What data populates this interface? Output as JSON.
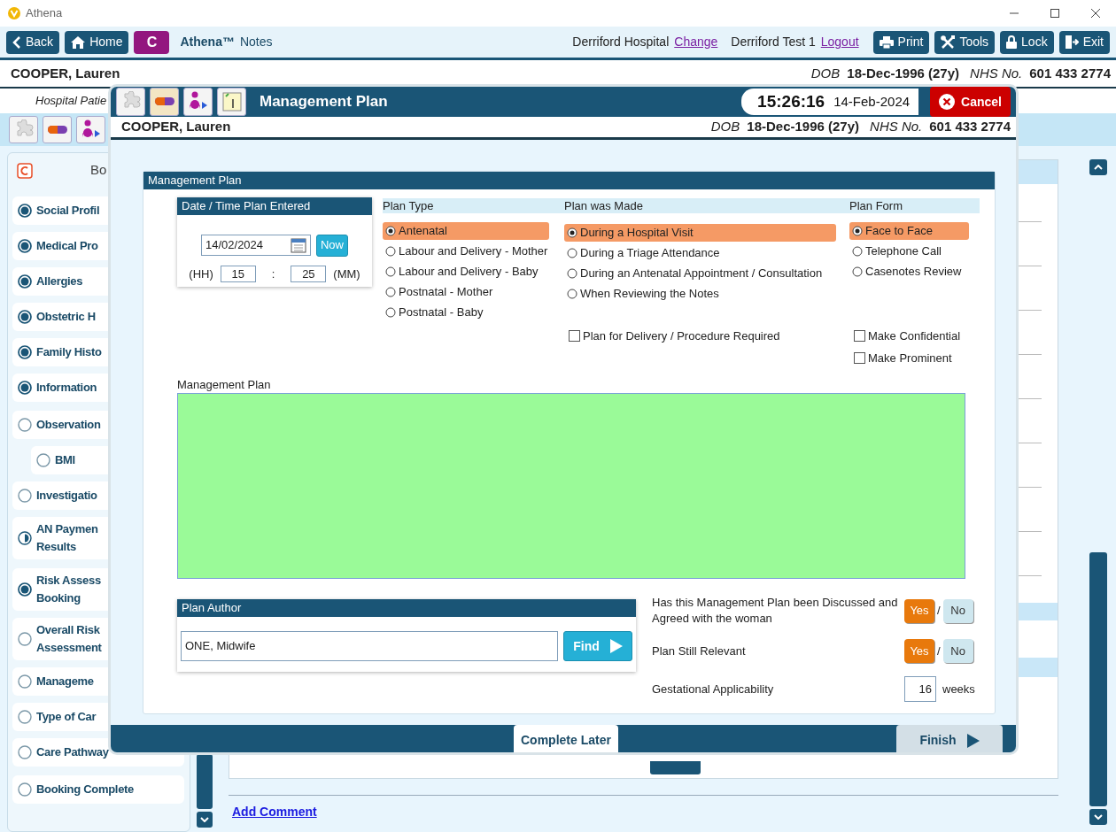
{
  "window": {
    "title": "Athena"
  },
  "toolbar": {
    "left_buttons": [
      {
        "label": "Back"
      },
      {
        "label": "Home"
      }
    ],
    "brand_button": "C",
    "app_name": "Athena™",
    "app_suffix": "Notes",
    "location": "Derriford Hospital",
    "location_link": "Change",
    "user": "Derriford Test 1",
    "user_link": "Logout",
    "right_buttons": [
      {
        "label": "Print"
      },
      {
        "label": "Tools"
      },
      {
        "label": "Lock"
      },
      {
        "label": "Exit"
      }
    ]
  },
  "patient": {
    "name": "COOPER, Lauren",
    "dob_label": "DOB",
    "dob": "18-Dec-1996 (27y)",
    "nhs_label": "NHS No.",
    "nhs": "601 433 2774"
  },
  "subheader": "Hospital Patie",
  "sidebar": {
    "header": "Bo",
    "groups": [
      {
        "items": [
          {
            "lines": [
              "Social Profil"
            ],
            "complete": true,
            "partial": false
          },
          {
            "lines": [
              "Medical Pro"
            ],
            "complete": true,
            "partial": false
          },
          {
            "lines": [
              "Allergies"
            ],
            "complete": true,
            "partial": false
          },
          {
            "lines": [
              "Obstetric H"
            ],
            "complete": true,
            "partial": false
          },
          {
            "lines": [
              "Family Histo"
            ],
            "complete": true,
            "partial": false
          },
          {
            "lines": [
              "Information"
            ],
            "complete": true,
            "partial": false
          }
        ]
      },
      {
        "items": [
          {
            "lines": [
              "Observation"
            ],
            "complete": false,
            "partial": false,
            "children": [
              {
                "lines": [
                  "BMI"
                ],
                "complete": false,
                "partial": false
              }
            ]
          },
          {
            "lines": [
              "Investigatio"
            ],
            "complete": false,
            "partial": false
          },
          {
            "lines": [
              "AN Paymen",
              "Results"
            ],
            "complete": false,
            "partial": true
          }
        ]
      },
      {
        "items": [
          {
            "lines": [
              "Risk Assess",
              "Booking"
            ],
            "complete": true,
            "partial": false
          },
          {
            "lines": [
              "Overall Risk",
              "Assessment"
            ],
            "complete": false,
            "partial": false
          },
          {
            "lines": [
              "Manageme"
            ],
            "complete": false,
            "partial": false
          },
          {
            "lines": [
              "Type of Car"
            ],
            "complete": false,
            "partial": false
          },
          {
            "lines": [
              "Care Pathway"
            ],
            "complete": false,
            "partial": false
          }
        ]
      },
      {
        "items": [
          {
            "lines": [
              "Booking Complete"
            ],
            "complete": false,
            "partial": false
          }
        ]
      }
    ]
  },
  "content": {
    "add_comment": "Add Comment"
  },
  "modal": {
    "title": "Management Plan",
    "time": "15:26:16",
    "date": "14-Feb-2024",
    "cancel": "Cancel",
    "patient": {
      "name": "COOPER, Lauren",
      "dob_label": "DOB",
      "dob": "18-Dec-1996 (27y)",
      "nhs_label": "NHS No.",
      "nhs": "601 433 2774"
    },
    "section_title": "Management Plan",
    "date_box": {
      "title": "Date / Time Plan Entered",
      "date": "14/02/2024",
      "now": "Now",
      "hh_label": "(HH)",
      "hour": "15",
      "separator": ":",
      "minute": "25",
      "mm_label": "(MM)"
    },
    "groups": [
      {
        "title": "Plan Type",
        "options": [
          {
            "label": "Antenatal",
            "selected": true
          },
          {
            "label": "Labour and Delivery - Mother",
            "selected": false
          },
          {
            "label": "Labour and Delivery - Baby",
            "selected": false
          },
          {
            "label": "Postnatal - Mother",
            "selected": false
          },
          {
            "label": "Postnatal - Baby",
            "selected": false
          }
        ]
      },
      {
        "title": "Plan was Made",
        "options": [
          {
            "label": "During a Hospital Visit",
            "selected": true
          },
          {
            "label": "During a Triage Attendance",
            "selected": false
          },
          {
            "label": "During an Antenatal Appointment / Consultation",
            "selected": false
          },
          {
            "label": "When Reviewing the Notes",
            "selected": false
          }
        ],
        "checkboxes": [
          {
            "label": "Plan for Delivery / Procedure Required",
            "checked": false
          }
        ]
      },
      {
        "title": "Plan Form",
        "options": [
          {
            "label": "Face to Face",
            "selected": true
          },
          {
            "label": "Telephone Call",
            "selected": false
          },
          {
            "label": "Casenotes Review",
            "selected": false
          }
        ],
        "checkboxes": [
          {
            "label": "Make Confidential",
            "checked": false
          },
          {
            "label": "Make Prominent",
            "checked": false
          }
        ]
      }
    ],
    "notes_label": "Management Plan",
    "author": {
      "title": "Plan Author",
      "value": "ONE, Midwife",
      "find": "Find"
    },
    "questions": [
      {
        "kind": "yesno",
        "label": "Has this Management Plan been Discussed and Agreed with the woman",
        "separator": "/",
        "options": [
          {
            "label": "Yes",
            "selected": true
          },
          {
            "label": "No",
            "selected": false
          }
        ]
      },
      {
        "kind": "yesno",
        "label": "Plan Still Relevant",
        "separator": "/",
        "options": [
          {
            "label": "Yes",
            "selected": true
          },
          {
            "label": "No",
            "selected": false
          }
        ]
      },
      {
        "kind": "number",
        "label": "Gestational Applicability",
        "value": "16",
        "unit": "weeks"
      }
    ],
    "footer": {
      "complete_later": "Complete Later",
      "finish": "Finish",
      "finish_disabled": true
    }
  }
}
